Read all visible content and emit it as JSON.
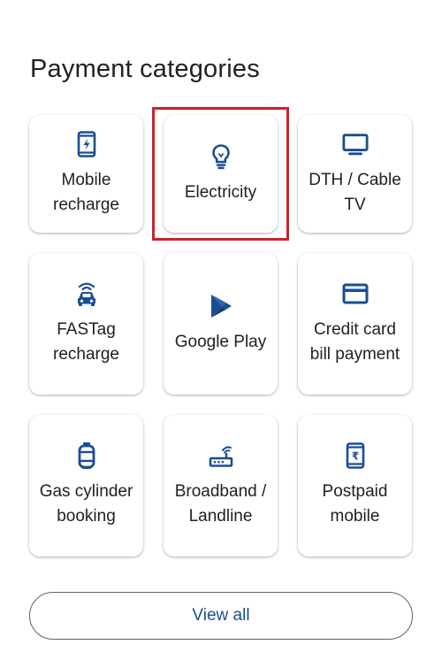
{
  "section": {
    "title": "Payment categories"
  },
  "colors": {
    "icon": "#1a4e94",
    "text": "#202124",
    "highlight": "#d32027",
    "link": "#1a4e94"
  },
  "categories": [
    {
      "label": "Mobile recharge",
      "icon": "mobile-bolt-icon"
    },
    {
      "label": "Electricity",
      "icon": "lightbulb-icon",
      "highlighted": true
    },
    {
      "label": "DTH / Cable TV",
      "icon": "tv-icon"
    },
    {
      "label": "FASTag recharge",
      "icon": "car-signal-icon"
    },
    {
      "label": "Google Play",
      "icon": "play-store-icon"
    },
    {
      "label": "Credit card bill payment",
      "icon": "credit-card-icon"
    },
    {
      "label": "Gas cylinder booking",
      "icon": "gas-cylinder-icon"
    },
    {
      "label": "Broadband / Landline",
      "icon": "router-icon"
    },
    {
      "label": "Postpaid mobile",
      "icon": "mobile-rupee-icon"
    }
  ],
  "view_all": {
    "label": "View all"
  }
}
